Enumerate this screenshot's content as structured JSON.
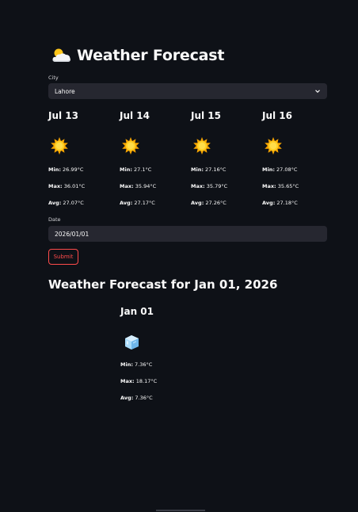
{
  "header": {
    "title": "Weather Forecast",
    "icon": "sun-behind-cloud-icon"
  },
  "city": {
    "label": "City",
    "selected": "Lahore"
  },
  "forecast": [
    {
      "date": "Jul 13",
      "icon": "sun-icon",
      "min_label": "Min:",
      "min": "26.99°C",
      "max_label": "Max:",
      "max": "36.01°C",
      "avg_label": "Avg:",
      "avg": "27.07°C"
    },
    {
      "date": "Jul 14",
      "icon": "sun-icon",
      "min_label": "Min:",
      "min": "27.1°C",
      "max_label": "Max:",
      "max": "35.94°C",
      "avg_label": "Avg:",
      "avg": "27.17°C"
    },
    {
      "date": "Jul 15",
      "icon": "sun-icon",
      "min_label": "Min:",
      "min": "27.16°C",
      "max_label": "Max:",
      "max": "35.79°C",
      "avg_label": "Avg:",
      "avg": "27.26°C"
    },
    {
      "date": "Jul 16",
      "icon": "sun-icon",
      "min_label": "Min:",
      "min": "27.08°C",
      "max_label": "Max:",
      "max": "35.65°C",
      "avg_label": "Avg:",
      "avg": "27.18°C"
    }
  ],
  "date_input": {
    "label": "Date",
    "value": "2026/01/01"
  },
  "submit": {
    "label": "Submit"
  },
  "result": {
    "title": "Weather Forecast for Jan 01, 2026",
    "date": "Jan 01",
    "icon": "ice-cube-icon",
    "min_label": "Min:",
    "min": "7.36°C",
    "max_label": "Max:",
    "max": "18.17°C",
    "avg_label": "Avg:",
    "avg": "7.36°C"
  },
  "colors": {
    "background": "#0e1117",
    "input_bg": "#262730",
    "accent": "#ff4b4b",
    "text": "#fafafa"
  }
}
